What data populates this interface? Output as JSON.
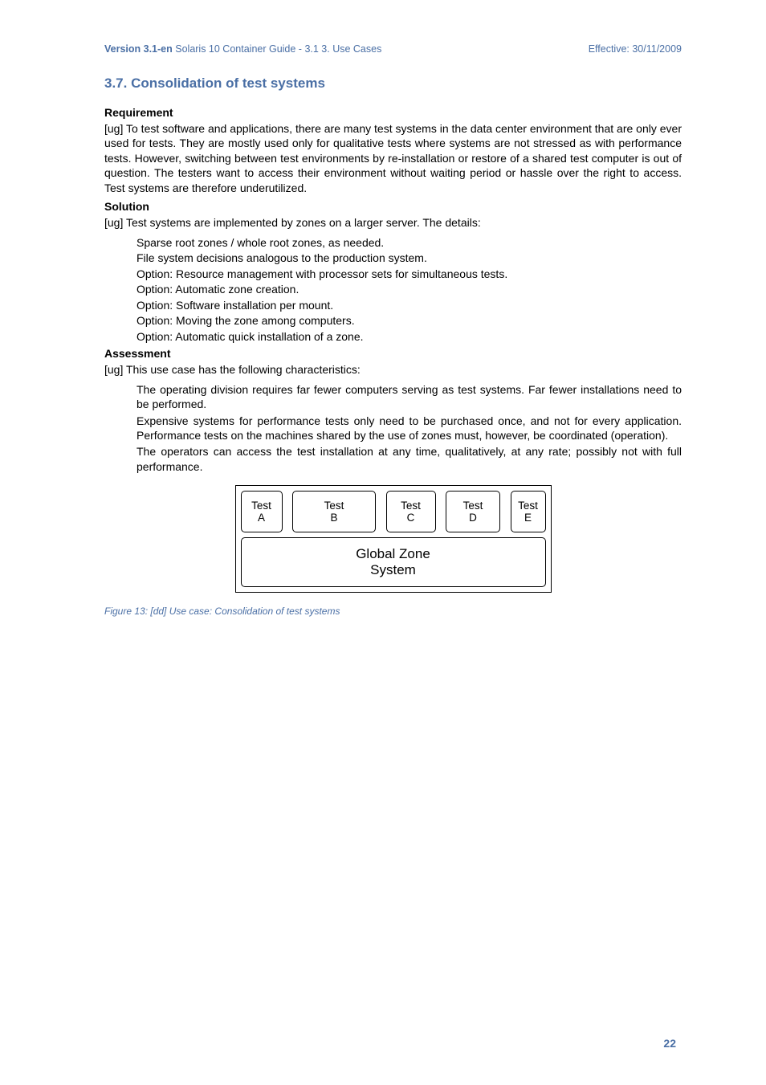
{
  "header": {
    "version_label": "Version 3.1-en",
    "title_trail": "Solaris 10 Container Guide - 3.1   3. Use Cases",
    "effective": "Effective: 30/11/2009"
  },
  "section_title": "3.7. Consolidation of test systems",
  "requirement": {
    "heading": "Requirement",
    "text": "[ug] To test software and applications, there are many test systems in the data center environment that are only ever used for tests. They are mostly used only for qualitative tests where systems are not stressed as with performance tests. However, switching between test environments by re-installation or restore of a shared test computer is out of question. The testers want to access their environment without waiting period or hassle over the right to access. Test systems are therefore underutilized."
  },
  "solution": {
    "heading": "Solution",
    "intro": "[ug] Test systems are implemented by zones on a larger server. The details:",
    "items": [
      "Sparse root zones / whole root zones, as needed.",
      "File system decisions analogous to the production system.",
      "Option: Resource management with processor sets for simultaneous tests.",
      "Option: Automatic zone creation.",
      "Option: Software installation per mount.",
      "Option: Moving the zone among computers.",
      "Option: Automatic quick installation of a zone."
    ]
  },
  "assessment": {
    "heading": "Assessment",
    "intro": "[ug] This use case has the following characteristics:",
    "items": [
      "The operating division requires far fewer computers serving as test systems. Far fewer installations need to be performed.",
      "Expensive systems for performance tests only need to be purchased once, and not for every application. Performance tests on the machines shared by the use of zones must, however, be coordinated (operation).",
      "The operators can access the test installation at any time, qualitatively, at any rate; possibly not with full performance."
    ]
  },
  "diagram": {
    "zones": {
      "a": "Test\nA",
      "b": "Test\nB",
      "c": "Test\nC",
      "d": "Test\nD",
      "e": "Test\nE"
    },
    "global": "Global Zone\nSystem"
  },
  "caption": "Figure 13: [dd] Use case: Consolidation of test systems",
  "page_number": "22"
}
